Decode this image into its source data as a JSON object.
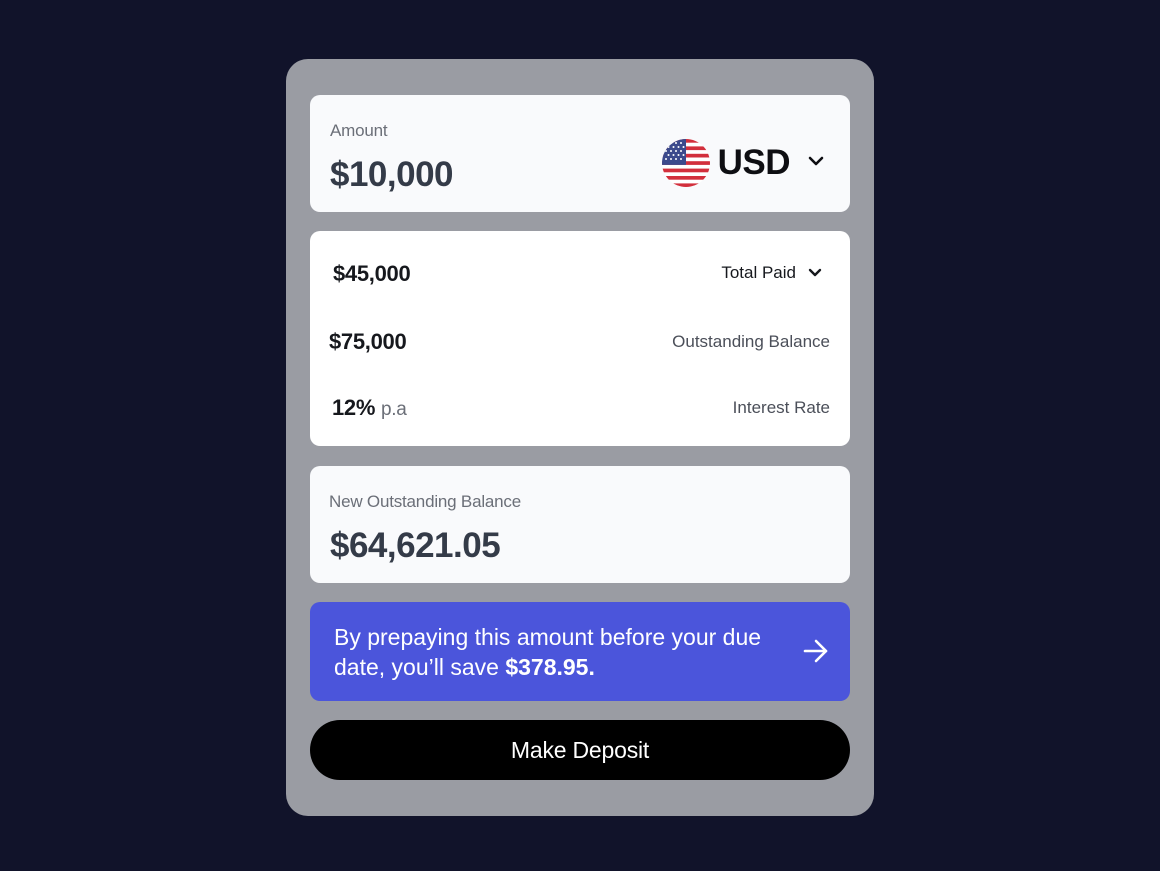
{
  "amount_card": {
    "label": "Amount",
    "value": "$10,000",
    "currency": {
      "code": "USD",
      "flag_icon": "us-flag-icon",
      "dropdown_icon": "chevron-down-icon"
    }
  },
  "details": [
    {
      "value": "$45,000",
      "unit": "",
      "label": "Total Paid",
      "dropdown": true
    },
    {
      "value": "$75,000",
      "unit": "",
      "label": "Outstanding Balance",
      "dropdown": false
    },
    {
      "value": "12%",
      "unit": "p.a",
      "label": "Interest Rate",
      "dropdown": false
    }
  ],
  "new_balance": {
    "label": "New Outstanding Balance",
    "value": "$64,621.05"
  },
  "promo": {
    "text_prefix": "By prepaying this amount before your due date, you’ll save ",
    "savings": "$378.95.",
    "icon": "arrow-right-icon"
  },
  "deposit_button": {
    "label": "Make Deposit"
  },
  "colors": {
    "background": "#11132a",
    "panel": "#9a9ca3",
    "promo": "#4b55db",
    "button": "#000000"
  }
}
